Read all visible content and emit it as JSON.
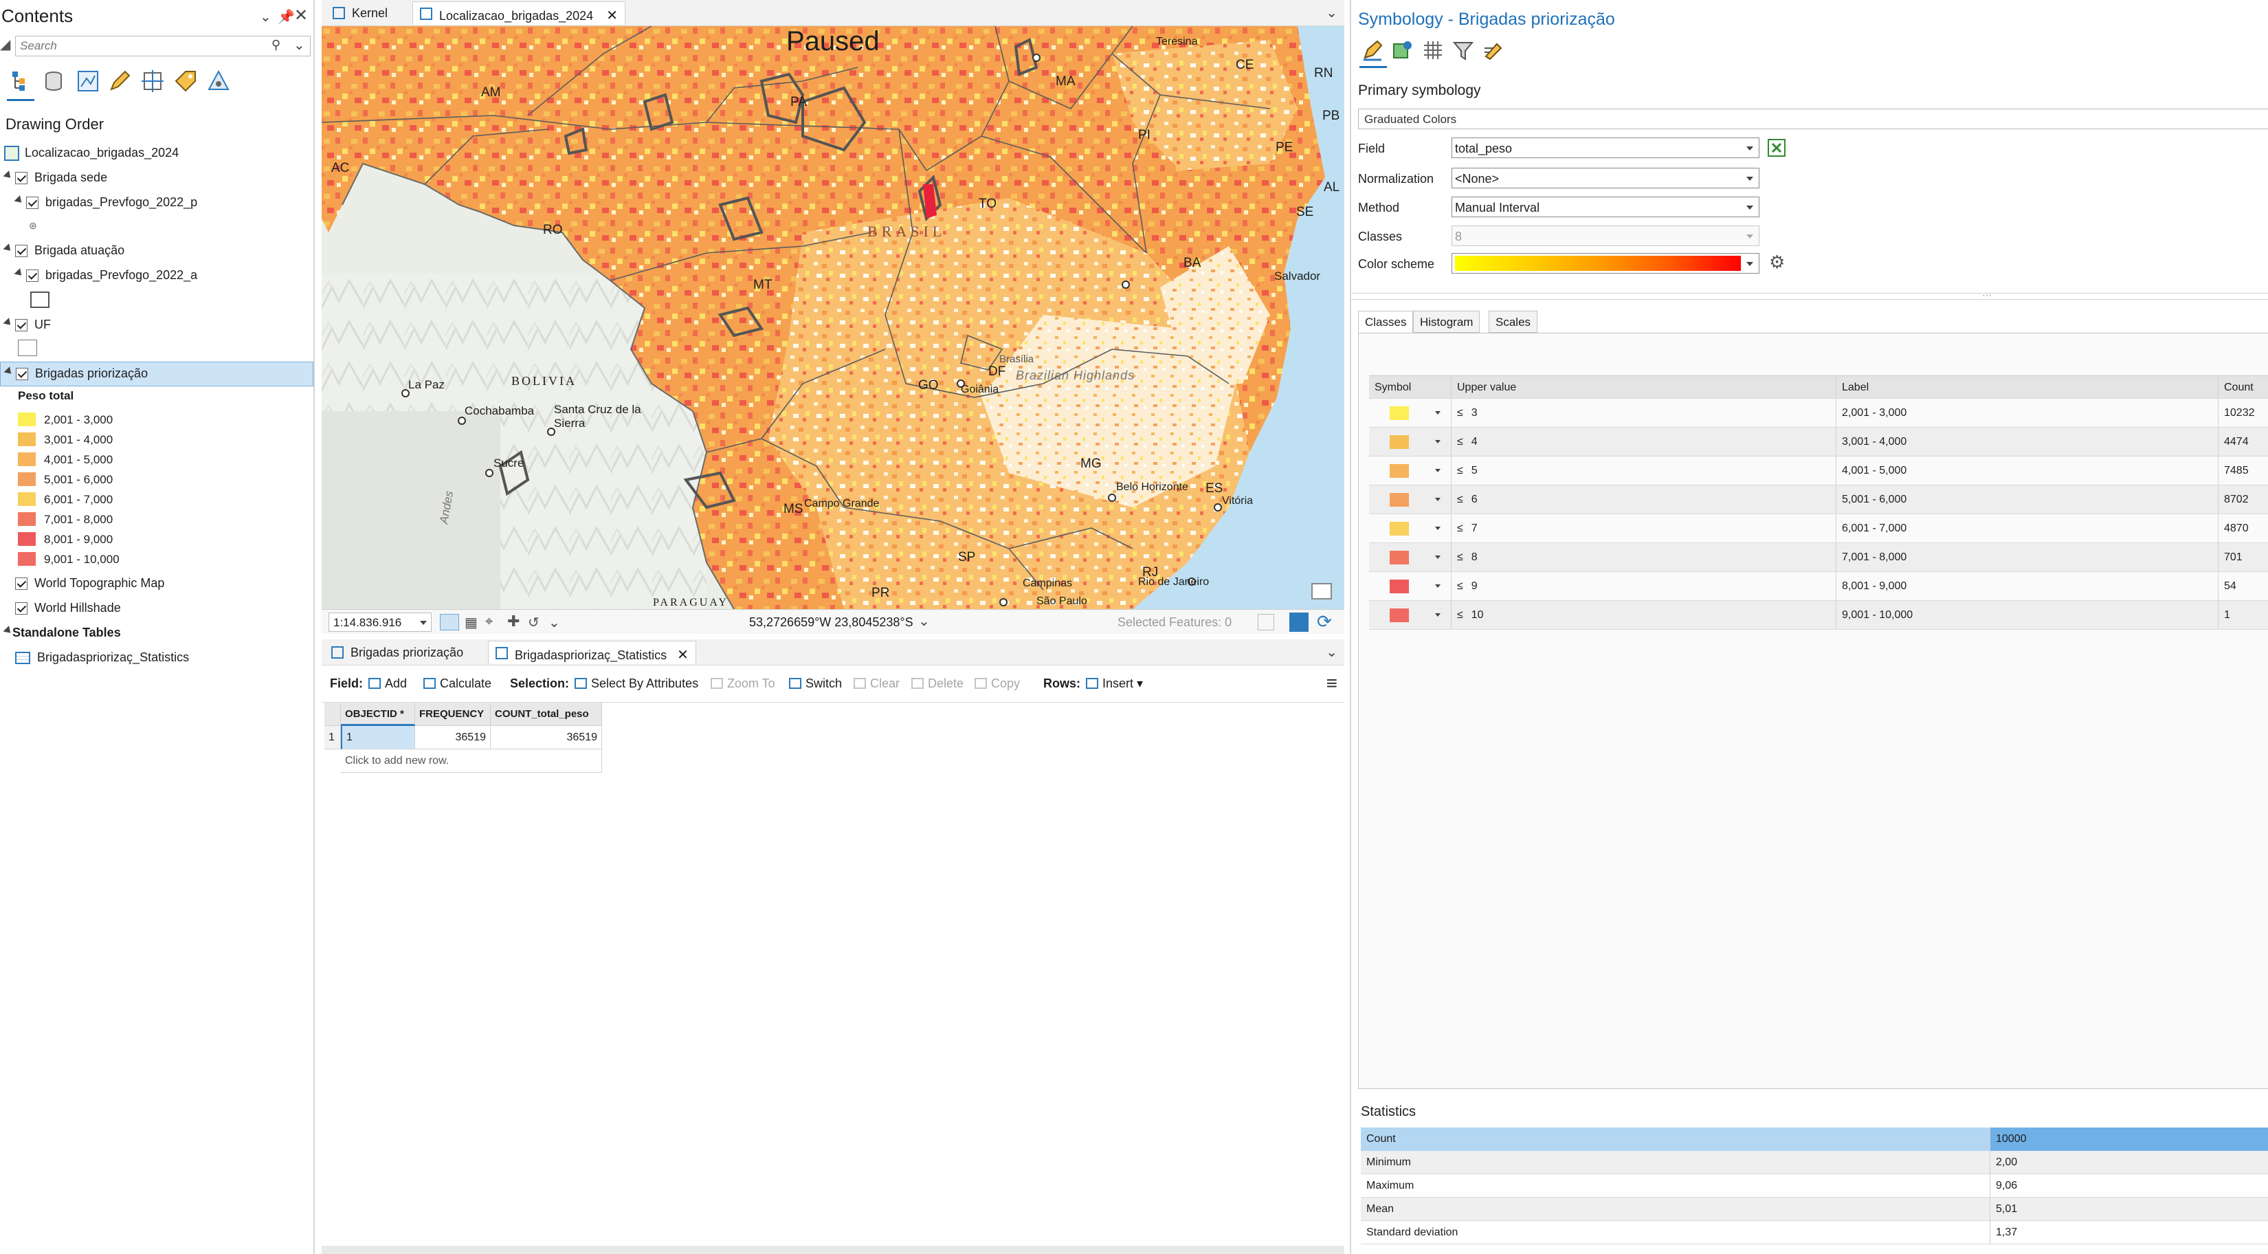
{
  "contents": {
    "title": "Contents",
    "search_placeholder": "Search",
    "drawing_order": "Drawing Order",
    "map_name": "Localizacao_brigadas_2024",
    "layers": {
      "brigada_sede": "Brigada sede",
      "brigadas_p": "brigadas_Prevfogo_2022_p",
      "brigada_atuacao": "Brigada atuação",
      "brigadas_a": "brigadas_Prevfogo_2022_a",
      "uf": "UF",
      "brigadas_priorizacao": "Brigadas priorização",
      "legend_title": "Peso total",
      "world_topo": "World Topographic Map",
      "world_hillshade": "World Hillshade",
      "standalone_tables": "Standalone Tables",
      "stats_table": "Brigadaspriorizaç_Statistics"
    },
    "legend": [
      {
        "label": "2,001 - 3,000",
        "color": "#fbef55"
      },
      {
        "label": "3,001 - 4,000",
        "color": "#f5bf55"
      },
      {
        "label": "4,001 - 5,000",
        "color": "#f7b45c"
      },
      {
        "label": "5,001 - 6,000",
        "color": "#f4a05e"
      },
      {
        "label": "6,001 - 7,000",
        "color": "#f8d05c"
      },
      {
        "label": "7,001 - 8,000",
        "color": "#f0785e"
      },
      {
        "label": "8,001 - 9,000",
        "color": "#ee5a5c"
      },
      {
        "label": "9,001 - 10,000",
        "color": "#ef6a62"
      }
    ]
  },
  "map": {
    "tabs": {
      "kernel": "Kernel",
      "active": "Localizacao_brigadas_2024"
    },
    "paused": "Paused",
    "labels": {
      "am": "AM",
      "pa": "PA",
      "ma": "MA",
      "ce": "CE",
      "rn": "RN",
      "pb": "PB",
      "pe": "PE",
      "al": "AL",
      "se": "SE",
      "pi": "PI",
      "ac": "AC",
      "ro": "RO",
      "to": "TO",
      "ba": "BA",
      "mt": "MT",
      "go": "GO",
      "df": "DF",
      "mg": "MG",
      "es": "ES",
      "ms": "MS",
      "sp": "SP",
      "rj": "RJ",
      "pr": "PR",
      "teresina": "Teresina",
      "salvador": "Salvador",
      "brasilia": "Brasília",
      "goiania": "Goiânia",
      "highlands": "Brazilian Highlands",
      "bh": "Belo Horizonte",
      "vitoria": "Vitória",
      "campinas": "Campinas",
      "rio": "Rio de Janeiro",
      "saopaulo": "São Paulo",
      "campo_grande": "Campo Grande",
      "bolivia": "BOLIVIA",
      "lapaz": "La Paz",
      "cochabamba": "Cochabamba",
      "santacruz1": "Santa Cruz de la",
      "santacruz2": "Sierra",
      "sucre": "Sucre",
      "andes": "Andes",
      "paraguay": "PARAGUAY",
      "brasil": "BRASIL"
    },
    "status": {
      "scale": "1:14.836.916",
      "coords": "53,2726659°W 23,8045238°S",
      "selected": "Selected Features: 0"
    }
  },
  "table_view": {
    "tabs": {
      "first": "Brigadas priorização",
      "second": "Brigadaspriorizaç_Statistics"
    },
    "toolbar": {
      "field": "Field:",
      "add": "Add",
      "calculate": "Calculate",
      "selection": "Selection:",
      "select_by_attr": "Select By Attributes",
      "zoom_to": "Zoom To",
      "switch": "Switch",
      "clear": "Clear",
      "delete": "Delete",
      "copy": "Copy",
      "rows": "Rows:",
      "insert": "Insert"
    },
    "columns": [
      "OBJECTID *",
      "FREQUENCY",
      "COUNT_total_peso"
    ],
    "rows": [
      [
        "1",
        "36519",
        "36519"
      ]
    ],
    "row_num": "1",
    "add_row": "Click to add new row."
  },
  "symbology": {
    "title": "Symbology - Brigadas priorização",
    "primary": "Primary symbology",
    "renderer": "Graduated Colors",
    "field_label": "Field",
    "field_value": "total_peso",
    "normalization_label": "Normalization",
    "normalization_value": "<None>",
    "method_label": "Method",
    "method_value": "Manual Interval",
    "classes_label": "Classes",
    "classes_value": "8",
    "color_scheme_label": "Color scheme",
    "tabs": [
      "Classes",
      "Histogram",
      "Scales"
    ],
    "columns": {
      "symbol": "Symbol",
      "upper": "Upper value",
      "label": "Label",
      "count": "Count"
    },
    "classes": [
      {
        "op": "≤",
        "upper": "3",
        "label": "2,001 - 3,000",
        "count": "10232",
        "color": "#fbef55"
      },
      {
        "op": "≤",
        "upper": "4",
        "label": "3,001 - 4,000",
        "count": "4474",
        "color": "#f5bf55"
      },
      {
        "op": "≤",
        "upper": "5",
        "label": "4,001 - 5,000",
        "count": "7485",
        "color": "#f7b45c"
      },
      {
        "op": "≤",
        "upper": "6",
        "label": "5,001 - 6,000",
        "count": "8702",
        "color": "#f4a05e"
      },
      {
        "op": "≤",
        "upper": "7",
        "label": "6,001 - 7,000",
        "count": "4870",
        "color": "#f8d05c"
      },
      {
        "op": "≤",
        "upper": "8",
        "label": "7,001 - 8,000",
        "count": "701",
        "color": "#f0785e"
      },
      {
        "op": "≤",
        "upper": "9",
        "label": "8,001 - 9,000",
        "count": "54",
        "color": "#ee5a5c"
      },
      {
        "op": "≤",
        "upper": "10",
        "label": "9,001 - 10,000",
        "count": "1",
        "color": "#ef6a62"
      }
    ],
    "statistics_label": "Statistics",
    "statistics": [
      {
        "key": "Count",
        "value": "10000"
      },
      {
        "key": "Minimum",
        "value": "2,00"
      },
      {
        "key": "Maximum",
        "value": "9,06"
      },
      {
        "key": "Mean",
        "value": "5,01"
      },
      {
        "key": "Standard deviation",
        "value": "1,37"
      }
    ]
  }
}
